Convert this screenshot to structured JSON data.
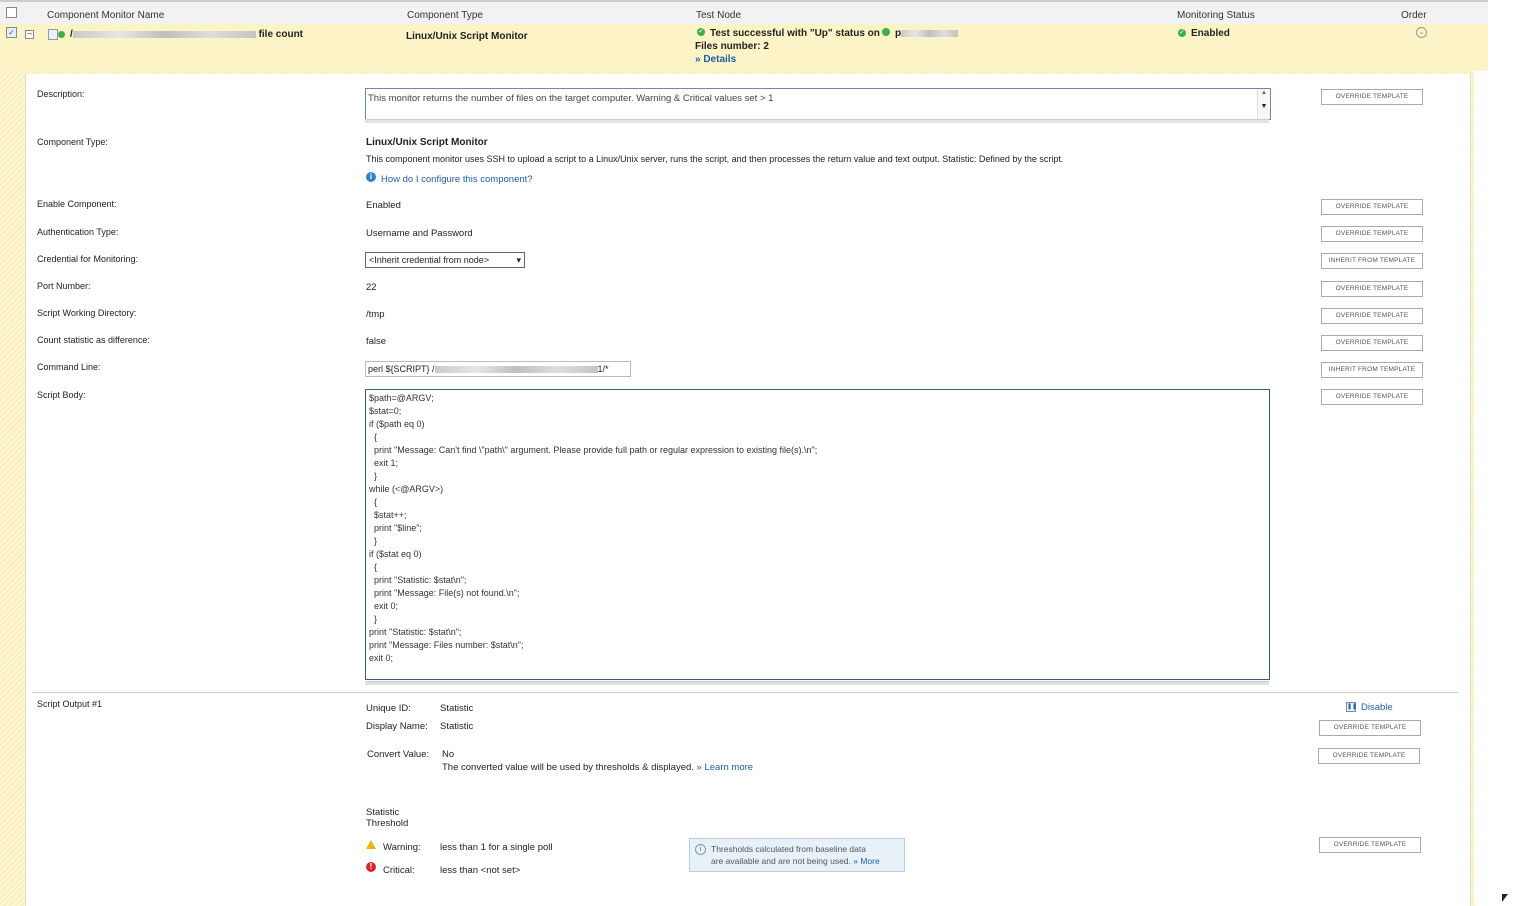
{
  "header": {
    "col_name": "Component Monitor Name",
    "col_type": "Component Type",
    "col_test": "Test Node",
    "col_status": "Monitoring Status",
    "col_order": "Order"
  },
  "row": {
    "name_suffix": "file count",
    "name_prefix": "/",
    "type": "Linux/Unix Script Monitor",
    "test_result": "Test successful with \"Up\" status on",
    "test_node_prefix": "p",
    "files_number": "Files number: 2",
    "details": "» Details",
    "status": "Enabled"
  },
  "form": {
    "description_label": "Description:",
    "description_value": "This monitor returns the number of files on the target computer.  Warning & Critical values set > 1",
    "component_type_label": "Component Type:",
    "component_type_value": "Linux/Unix Script Monitor",
    "component_type_desc": "This component monitor uses SSH to upload a script to a Linux/Unix server, runs the script, and then processes the return value and text output. Statistic: Defined by the script.",
    "help_link": "How do I configure this component?",
    "enable_label": "Enable Component:",
    "enable_value": "Enabled",
    "auth_label": "Authentication Type:",
    "auth_value": "Username and Password",
    "credential_label": "Credential for Monitoring:",
    "credential_value": "<Inherit credential from node>",
    "port_label": "Port Number:",
    "port_value": "22",
    "workdir_label": "Script Working Directory:",
    "workdir_value": "/tmp",
    "count_label": "Count statistic as difference:",
    "count_value": "false",
    "cmd_label": "Command Line:",
    "cmd_prefix": "perl ${SCRIPT} /",
    "cmd_suffix": "1/*",
    "script_label": "Script Body:",
    "script_body": "$path=@ARGV;\n$stat=0;\nif ($path eq 0)\n  {\n  print \"Message: Can't find \\\"path\\\" argument. Please provide full path or regular expression to existing file(s).\\n\";\n  exit 1;\n  }\nwhile (<@ARGV>)\n  {\n  $stat++;\n  print \"$line\";\n  }\nif ($stat eq 0)\n  {\n  print \"Statistic: $stat\\n\";\n  print \"Message: File(s) not found.\\n\";\n  exit 0;\n  }\nprint \"Statistic: $stat\\n\";\nprint \"Message: Files number: $stat\\n\";\nexit 0;"
  },
  "buttons": {
    "override": "OVERRIDE TEMPLATE",
    "inherit": "INHERIT FROM TEMPLATE"
  },
  "output": {
    "section_label": "Script Output #1",
    "disable": "Disable",
    "unique_id_label": "Unique ID:",
    "unique_id_value": "Statistic",
    "display_name_label": "Display Name:",
    "display_name_value": "Statistic",
    "convert_label": "Convert Value:",
    "convert_value": "No",
    "convert_note": "The converted value will be used by thresholds & displayed.",
    "learn_more": "» Learn more",
    "threshold_title_1": "Statistic",
    "threshold_title_2": "Threshold",
    "warning_label": "Warning:",
    "warning_value": "less than 1  for a single poll",
    "critical_label": "Critical:",
    "critical_value": "less than <not set>",
    "baseline_line1": "Thresholds calculated from baseline data",
    "baseline_line2": "are available and are not being used.",
    "baseline_more": "» More"
  },
  "colors": {
    "accent_link": "#1f5fa6",
    "row_bg": "#fcf3c6",
    "ok_green": "#3cb043",
    "warn": "#f0b400",
    "crit": "#d9262b"
  }
}
